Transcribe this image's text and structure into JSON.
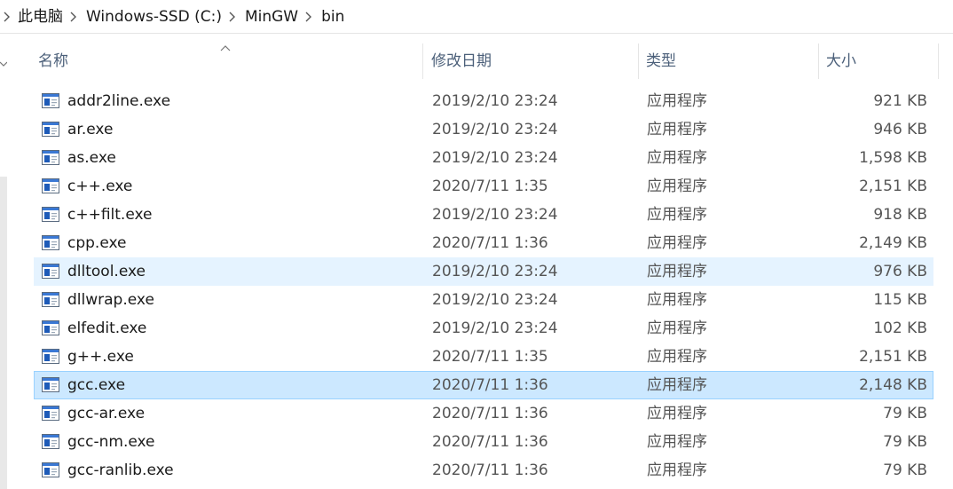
{
  "breadcrumb": [
    "此电脑",
    "Windows-SSD (C:)",
    "MinGW",
    "bin"
  ],
  "columns": {
    "name": "名称",
    "date": "修改日期",
    "type": "类型",
    "size": "大小"
  },
  "files": [
    {
      "name": "addr2line.exe",
      "date": "2019/2/10 23:24",
      "type": "应用程序",
      "size": "921 KB",
      "state": "normal"
    },
    {
      "name": "ar.exe",
      "date": "2019/2/10 23:24",
      "type": "应用程序",
      "size": "946 KB",
      "state": "normal"
    },
    {
      "name": "as.exe",
      "date": "2019/2/10 23:24",
      "type": "应用程序",
      "size": "1,598 KB",
      "state": "normal"
    },
    {
      "name": "c++.exe",
      "date": "2020/7/11 1:35",
      "type": "应用程序",
      "size": "2,151 KB",
      "state": "normal"
    },
    {
      "name": "c++filt.exe",
      "date": "2019/2/10 23:24",
      "type": "应用程序",
      "size": "918 KB",
      "state": "normal"
    },
    {
      "name": "cpp.exe",
      "date": "2020/7/11 1:36",
      "type": "应用程序",
      "size": "2,149 KB",
      "state": "normal"
    },
    {
      "name": "dlltool.exe",
      "date": "2019/2/10 23:24",
      "type": "应用程序",
      "size": "976 KB",
      "state": "hover"
    },
    {
      "name": "dllwrap.exe",
      "date": "2019/2/10 23:24",
      "type": "应用程序",
      "size": "115 KB",
      "state": "normal"
    },
    {
      "name": "elfedit.exe",
      "date": "2019/2/10 23:24",
      "type": "应用程序",
      "size": "102 KB",
      "state": "normal"
    },
    {
      "name": "g++.exe",
      "date": "2020/7/11 1:35",
      "type": "应用程序",
      "size": "2,151 KB",
      "state": "normal"
    },
    {
      "name": "gcc.exe",
      "date": "2020/7/11 1:36",
      "type": "应用程序",
      "size": "2,148 KB",
      "state": "selected"
    },
    {
      "name": "gcc-ar.exe",
      "date": "2020/7/11 1:36",
      "type": "应用程序",
      "size": "79 KB",
      "state": "normal"
    },
    {
      "name": "gcc-nm.exe",
      "date": "2020/7/11 1:36",
      "type": "应用程序",
      "size": "79 KB",
      "state": "normal"
    },
    {
      "name": "gcc-ranlib.exe",
      "date": "2020/7/11 1:36",
      "type": "应用程序",
      "size": "79 KB",
      "state": "normal"
    }
  ],
  "colors": {
    "hover": "#e5f3ff",
    "selected": "#cce8ff",
    "selected_border": "#99d1ff",
    "header_text": "#4c607a",
    "icon_blue": "#1e5bb8"
  },
  "icons": {
    "breadcrumb_separator": "chevron-right-icon",
    "sort_indicator": "chevron-up-icon",
    "file": "exe-app-icon"
  }
}
